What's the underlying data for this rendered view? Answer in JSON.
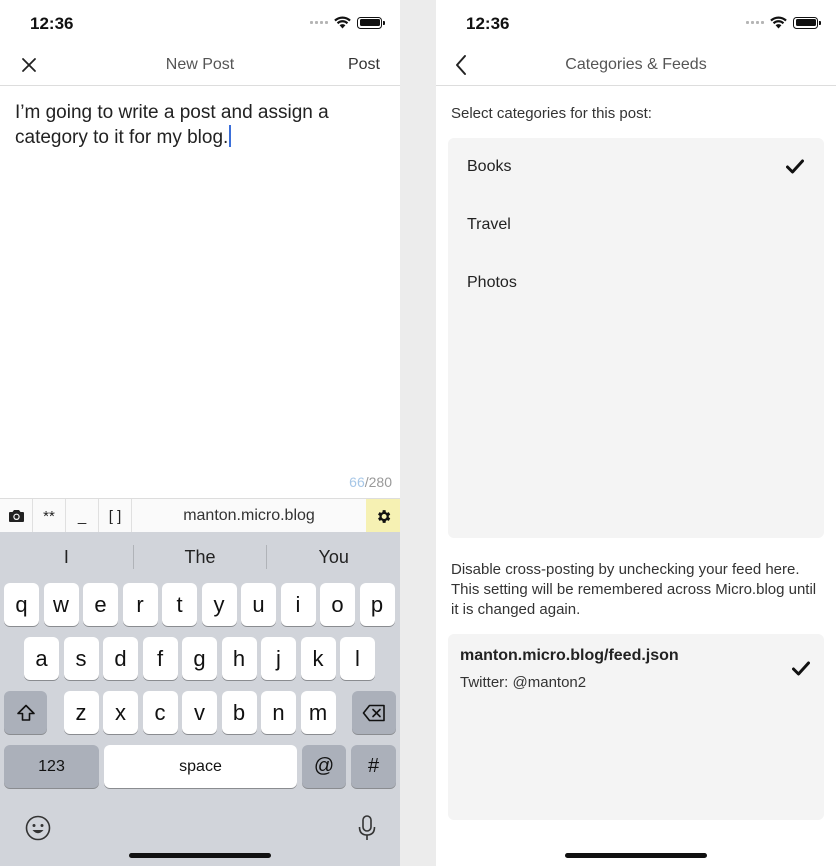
{
  "left_screen": {
    "status": {
      "time": "12:36"
    },
    "nav": {
      "title": "New Post",
      "post_label": "Post"
    },
    "editor": {
      "text": "I’m going to write a post and assign a category to it for my blog."
    },
    "counter": {
      "current": "66",
      "max": "/280"
    },
    "toolbar": {
      "bold_label": "**",
      "italic_label": "_",
      "link_label": "[ ]",
      "site": "manton.micro.blog"
    },
    "keyboard": {
      "suggestions": [
        "I",
        "The",
        "You"
      ],
      "row1": [
        "q",
        "w",
        "e",
        "r",
        "t",
        "y",
        "u",
        "i",
        "o",
        "p"
      ],
      "row2": [
        "a",
        "s",
        "d",
        "f",
        "g",
        "h",
        "j",
        "k",
        "l"
      ],
      "row3": [
        "z",
        "x",
        "c",
        "v",
        "b",
        "n",
        "m"
      ],
      "numbers_label": "123",
      "space_label": "space",
      "at_label": "@",
      "hash_label": "#"
    }
  },
  "right_screen": {
    "status": {
      "time": "12:36"
    },
    "nav": {
      "title": "Categories & Feeds"
    },
    "categories_prompt": "Select categories for this post:",
    "categories": [
      {
        "label": "Books",
        "checked": true
      },
      {
        "label": "Travel",
        "checked": false
      },
      {
        "label": "Photos",
        "checked": false
      }
    ],
    "feeds_note": [
      "Disable cross-posting by unchecking your feed here.",
      "This setting will be remembered across Micro.blog until",
      "it is changed again."
    ],
    "feed": {
      "name": "manton.micro.blog/feed.json",
      "sub": "Twitter: @manton2",
      "checked": true
    }
  }
}
